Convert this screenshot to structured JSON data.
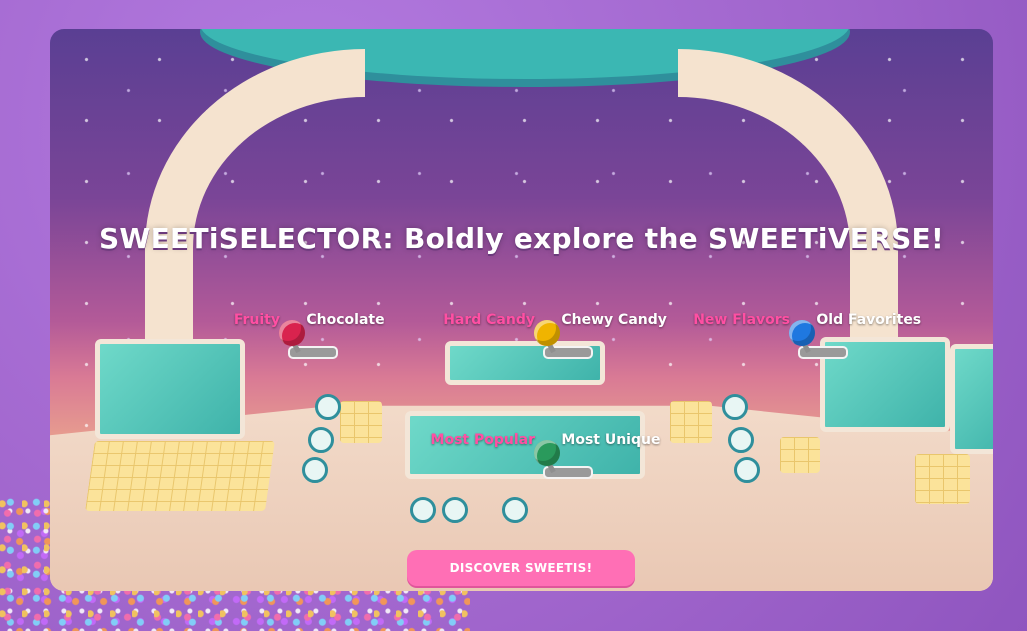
{
  "title": "SWEETiSELECTOR: Boldly explore the SWEETiVERSE!",
  "levers": [
    {
      "left_label": "Fruity",
      "right_label": "Chocolate",
      "knob_color": "#d9234e"
    },
    {
      "left_label": "Hard Candy",
      "right_label": "Chewy Candy",
      "knob_color": "#f0b400"
    },
    {
      "left_label": "New Flavors",
      "right_label": "Old Favorites",
      "knob_color": "#1f78e0"
    },
    {
      "left_label": "Most Popular",
      "right_label": "Most Unique",
      "knob_color": "#2a9a5c"
    }
  ],
  "cta": {
    "label": "DISCOVER SWEETIS!"
  },
  "colors": {
    "accent": "#ff6fb5",
    "left_label": "#ff4fa3",
    "frame": "#a66ad0"
  }
}
